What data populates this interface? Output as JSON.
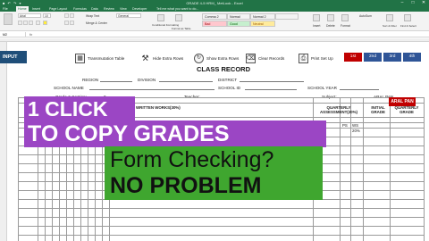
{
  "window": {
    "title": "GRADE 4-5 HRM_ MetLook - Excel",
    "qat": "■ ↶ ↷ ▾",
    "min": "–",
    "max": "□",
    "close": "✕"
  },
  "ribbon_tabs": [
    "File",
    "Home",
    "Insert",
    "Page Layout",
    "Formulas",
    "Data",
    "Review",
    "View",
    "Developer",
    "Tell me what you want to do..."
  ],
  "ribbon": {
    "font_name": "Arial",
    "font_size": "10",
    "wrap_text": "Wrap Text",
    "number_format": "General",
    "merge_center": "Merge & Center",
    "styles": [
      {
        "label": "Comma 2",
        "bg": "#ffffff"
      },
      {
        "label": "Normal",
        "bg": "#ffffff"
      },
      {
        "label": "Normal 2",
        "bg": "#ffffff"
      },
      {
        "label": "Bad",
        "bg": "#ffc7ce"
      },
      {
        "label": "Good",
        "bg": "#c6efce"
      },
      {
        "label": "Neutral",
        "bg": "#ffeb9c"
      }
    ],
    "conditional": "Conditional Formatting",
    "format_table": "Format as Table",
    "insert": "Insert",
    "delete": "Delete",
    "format": "Format",
    "autosum": "AutoSum",
    "sort": "Sort & Filter",
    "find": "Find & Select"
  },
  "formula_bar": {
    "name_box": "M2",
    "fx": "fx"
  },
  "toolbar": {
    "input": "INPUT",
    "transmutation": "Transmutation Table",
    "hide_rows": "Hide Extra Rows",
    "show_rows": "Show Extra Rows",
    "clear_records": "Clear Records",
    "print_setup": "Print Set Up",
    "quarters": [
      "1st",
      "2nd",
      "3rd",
      "4th"
    ]
  },
  "record": {
    "title": "CLASS RECORD",
    "region": "REGION",
    "division": "DIVISION",
    "district": "DISTRICT",
    "school_name": "SCHOOL NAME",
    "school_id": "SCHOOL ID",
    "school_year": "SCHOOL YEAR",
    "grade_section": "Grade & Section:",
    "teacher": "Teacher:",
    "subject": "Subject:",
    "subject_value": "ARAL PAN",
    "quarter_value": "0"
  },
  "grid": {
    "written_works": "WRITTEN WORKS(30%)",
    "quarterly_assessment": "QUARTERLY ASSESSMENT(20%)",
    "initial_grade": "INITIAL GRADE",
    "quarterly_grade": "QUARTERLY GRADE",
    "ps": "PS",
    "ws": "WS",
    "pct": "%",
    "weight": "20%"
  },
  "badge": "ARAL PAN",
  "overlay": {
    "line1": "1 CLICK",
    "line2": "TO COPY GRADES",
    "line3": "Form Checking?",
    "line4": "NO PROBLEM"
  },
  "colors": {
    "excel_green": "#217346",
    "purple_banner": "#9b46c4",
    "green_banner": "#3fa62f",
    "quarter_red": "#c00000",
    "quarter_blue": "#2f5597",
    "input_blue": "#1f4e79"
  }
}
